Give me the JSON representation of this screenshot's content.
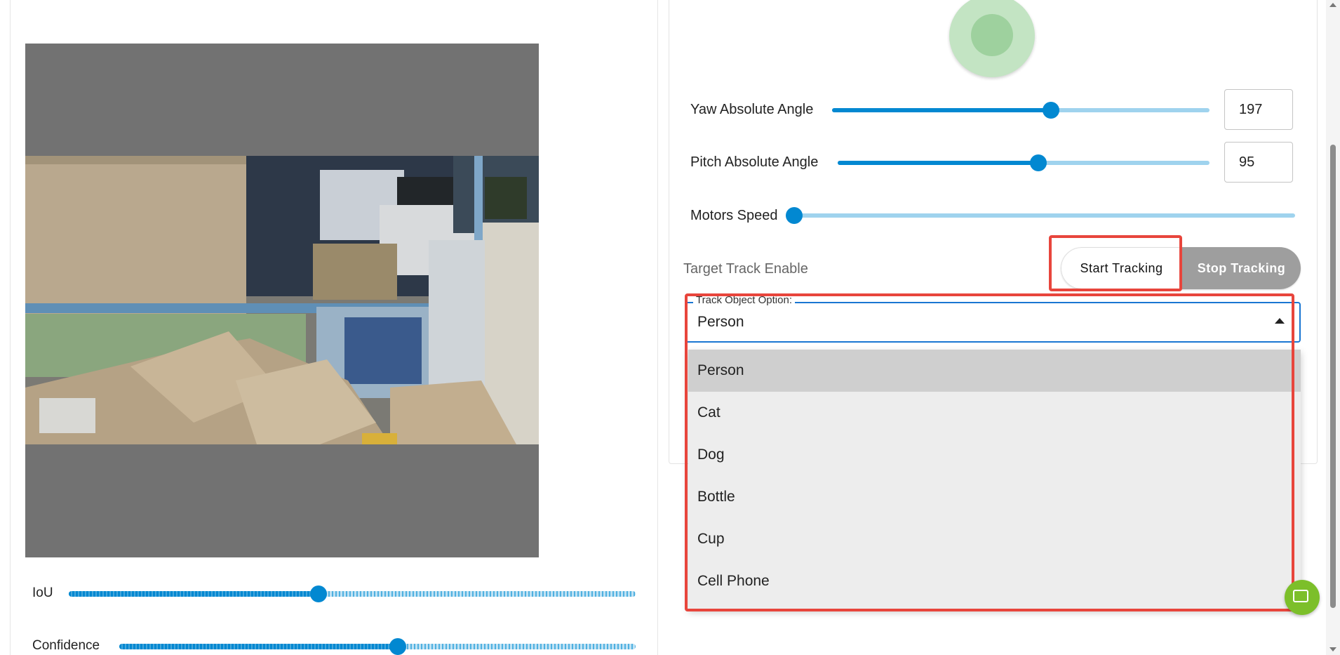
{
  "video": {
    "alt": "camera feed"
  },
  "detection": {
    "iou": {
      "label": "IoU",
      "value": 0.44
    },
    "confidence": {
      "label": "Confidence",
      "value": 0.54
    }
  },
  "gimbal": {
    "yaw": {
      "label": "Yaw Absolute Angle",
      "value": "197",
      "fraction": 0.58
    },
    "pitch": {
      "label": "Pitch Absolute Angle",
      "value": "95",
      "fraction": 0.54
    },
    "speed": {
      "label": "Motors Speed",
      "fraction": 0.0
    }
  },
  "tracking": {
    "label": "Target Track Enable",
    "start_label": "Start Tracking",
    "stop_label": "Stop Tracking"
  },
  "track_select": {
    "legend": "Track Object Option:",
    "value": "Person",
    "options": [
      "Person",
      "Cat",
      "Dog",
      "Bottle",
      "Cup",
      "Cell Phone"
    ],
    "selected_index": 0
  },
  "colors": {
    "accent": "#0288d1",
    "track": "#9fd3ee",
    "highlight": "#e8453c",
    "fab": "#7cbf2a"
  },
  "icons": {
    "fab": "code-icon"
  }
}
